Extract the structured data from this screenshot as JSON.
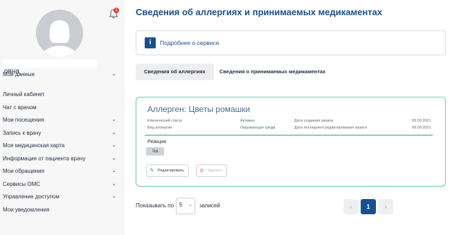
{
  "user": {
    "name_suffix": "овна",
    "notification_count": "1"
  },
  "sidebar": {
    "items": [
      {
        "label": "Мои данные",
        "has_chevron": true
      },
      {
        "label": "Личный кабинет",
        "has_chevron": false
      },
      {
        "label": "Чат с врачом",
        "has_chevron": false
      },
      {
        "label": "Мои посещения",
        "has_chevron": true
      },
      {
        "label": "Запись к врачу",
        "has_chevron": true
      },
      {
        "label": "Моя медицинская карта",
        "has_chevron": true
      },
      {
        "label": "Информация от пациента врачу",
        "has_chevron": true
      },
      {
        "label": "Мои обращения",
        "has_chevron": true
      },
      {
        "label": "Сервисы ОМС",
        "has_chevron": true
      },
      {
        "label": "Управление доступом",
        "has_chevron": true
      },
      {
        "label": "Мои уведомления",
        "has_chevron": false
      }
    ]
  },
  "main": {
    "title": "Сведения об аллергиях и принимаемых медикаментах",
    "info": {
      "icon": "i",
      "text": "Подробнее о сервисе"
    },
    "tabs": [
      {
        "label": "Сведения об аллергиях",
        "active": true
      },
      {
        "label": "Сведения о принимаемых медикаментах",
        "active": false
      }
    ],
    "card": {
      "title": "Аллерген: Цветы ромашки",
      "clinical_status_label": "Клинический статус",
      "clinical_status_value": "Активно",
      "allergy_type_label": "Вид аллергии",
      "allergy_type_value": "Окружающая среда",
      "created_label": "Дата создания записи",
      "created_value": "09.09.2021",
      "edited_label": "Дата последнего редактирования записи",
      "edited_value": "09.09.2021",
      "reaction_label": "Реакция",
      "reaction_chip": "Зуд",
      "edit_button": "Редактировать",
      "delete_button": "Удалить"
    },
    "pagination": {
      "per_page_prefix": "Показывать по",
      "per_page_value": "5",
      "per_page_suffix": "записей",
      "prev": "‹",
      "current": "1",
      "next": "›"
    }
  },
  "colors": {
    "accent": "#1a4f8b",
    "card_border": "#79c7b3",
    "status_green": "#2e7d5b"
  }
}
